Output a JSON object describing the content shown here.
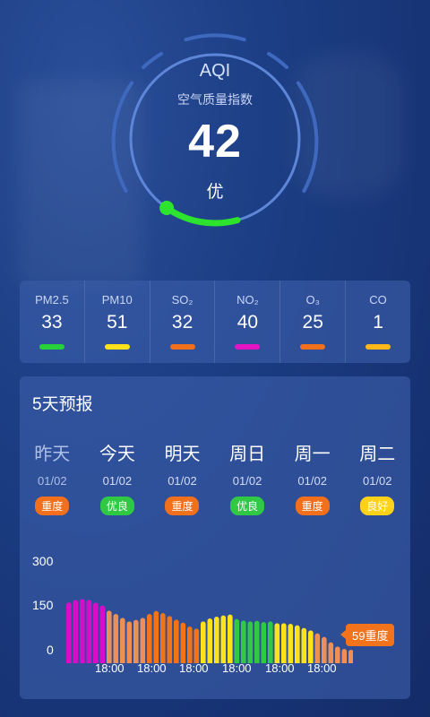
{
  "aqi": {
    "title": "AQI",
    "subtitle": "空气质量指数",
    "value": "42",
    "level": "优",
    "progress": 0.14
  },
  "pollutants": [
    {
      "name": "PM2.5",
      "value": "33",
      "color": "#27d13a"
    },
    {
      "name": "PM10",
      "value": "51",
      "color": "#ffe21a"
    },
    {
      "name": "SO₂",
      "value": "32",
      "color": "#f26f1c"
    },
    {
      "name": "NO₂",
      "value": "40",
      "color": "#e414c4"
    },
    {
      "name": "O₃",
      "value": "25",
      "color": "#f26f1c"
    },
    {
      "name": "CO",
      "value": "1",
      "color": "#ffb81a"
    }
  ],
  "forecast": {
    "title": "5天预报",
    "days": [
      {
        "name": "昨天",
        "date": "01/02",
        "badge": "重度",
        "badge_color": "#f26f1c"
      },
      {
        "name": "今天",
        "date": "01/02",
        "badge": "优良",
        "badge_color": "#2fc944"
      },
      {
        "name": "明天",
        "date": "01/02",
        "badge": "重度",
        "badge_color": "#f26f1c"
      },
      {
        "name": "周日",
        "date": "01/02",
        "badge": "优良",
        "badge_color": "#2fc944"
      },
      {
        "name": "周一",
        "date": "01/02",
        "badge": "重度",
        "badge_color": "#f26f1c"
      },
      {
        "name": "周二",
        "date": "01/02",
        "badge": "良好",
        "badge_color": "#ffd21a"
      }
    ]
  },
  "chart_data": {
    "type": "bar",
    "y_ticks": [
      "300",
      "150",
      "0"
    ],
    "ylim": [
      0,
      300
    ],
    "x_ticks": [
      "18:00",
      "18:00",
      "18:00",
      "18:00",
      "18:00",
      "18:00"
    ],
    "values": [
      204,
      212,
      215,
      212,
      203,
      193,
      176,
      165,
      152,
      140,
      145,
      152,
      165,
      175,
      168,
      158,
      146,
      136,
      123,
      116,
      140,
      150,
      156,
      160,
      163,
      148,
      143,
      140,
      142,
      138,
      140,
      134,
      134,
      132,
      127,
      118,
      110,
      100,
      88,
      70,
      56,
      48,
      45
    ],
    "colors": [
      "#d60ec8",
      "#d60ec8",
      "#d60ec8",
      "#d60ec8",
      "#d60ec8",
      "#d60ec8",
      "#ee8f56",
      "#ee8f56",
      "#ee8f56",
      "#ee8f56",
      "#ee8f56",
      "#ee8f56",
      "#f27417",
      "#f27417",
      "#f27417",
      "#f27417",
      "#f27417",
      "#f27417",
      "#f27417",
      "#f27417",
      "#ffe31a",
      "#ffe31a",
      "#ffe31a",
      "#ffe31a",
      "#ffe31a",
      "#2fc944",
      "#2fc944",
      "#2fc944",
      "#2fc944",
      "#2fc944",
      "#2fc944",
      "#ffe31a",
      "#ffe31a",
      "#ffe31a",
      "#ffe31a",
      "#ffe31a",
      "#ffe31a",
      "#ee8f56",
      "#ee8f56",
      "#ee8f56",
      "#ee8f56",
      "#ee8f56",
      "#ee8f56"
    ],
    "tooltip": "59重度"
  }
}
